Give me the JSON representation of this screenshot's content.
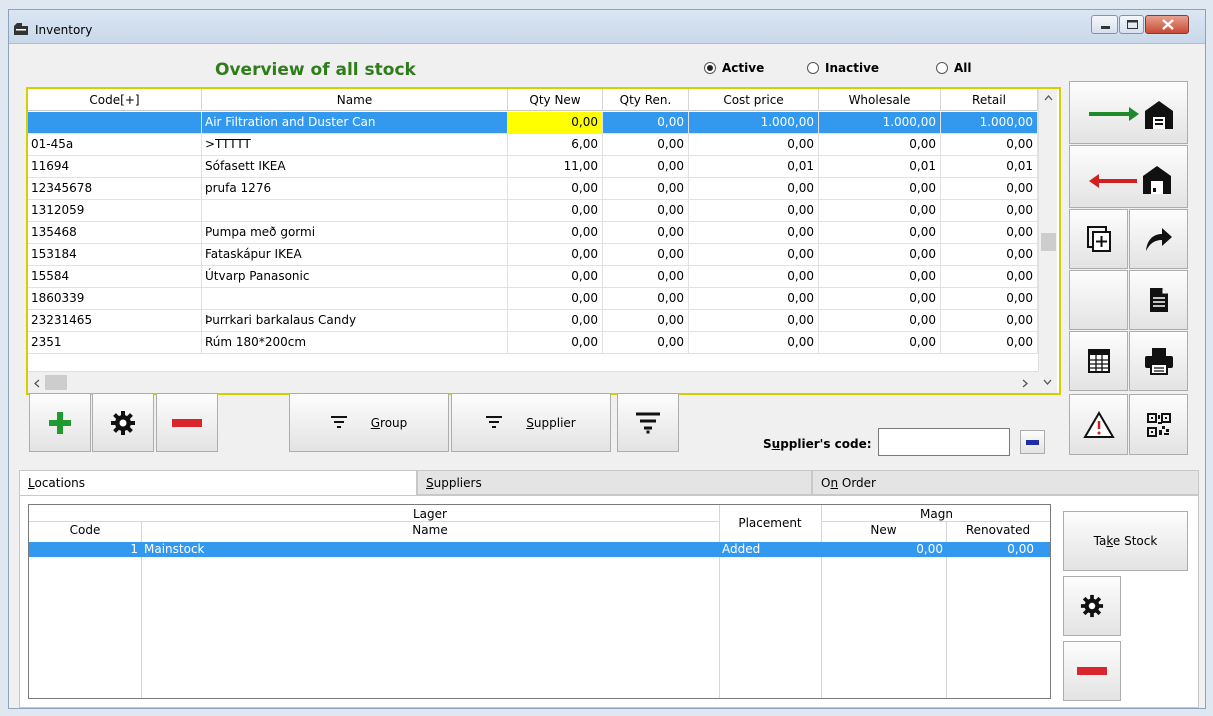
{
  "window": {
    "title": "Inventory"
  },
  "overview": {
    "title": "Overview of all stock"
  },
  "filters": {
    "active": "Active",
    "inactive": "Inactive",
    "all": "All"
  },
  "grid": {
    "columns": [
      "Code[+]",
      "Name",
      "Qty New",
      "Qty Ren.",
      "Cost price",
      "Wholesale",
      "Retail"
    ],
    "rows": [
      [
        "",
        "Air Filtration and Duster Can",
        "0,00",
        "0,00",
        "1.000,00",
        "1.000,00",
        "1.000,00"
      ],
      [
        "01-45a",
        ">TTTTT",
        "6,00",
        "0,00",
        "0,00",
        "0,00",
        "0,00"
      ],
      [
        "11694",
        "Sófasett IKEA",
        "11,00",
        "0,00",
        "0,01",
        "0,01",
        "0,01"
      ],
      [
        "12345678",
        "prufa 1276",
        "0,00",
        "0,00",
        "0,00",
        "0,00",
        "0,00"
      ],
      [
        "1312059",
        "",
        "0,00",
        "0,00",
        "0,00",
        "0,00",
        "0,00"
      ],
      [
        "135468",
        "Pumpa með gormi",
        "0,00",
        "0,00",
        "0,00",
        "0,00",
        "0,00"
      ],
      [
        "153184",
        "Fataskápur IKEA",
        "0,00",
        "0,00",
        "0,00",
        "0,00",
        "0,00"
      ],
      [
        "15584",
        "Útvarp Panasonic",
        "0,00",
        "0,00",
        "0,00",
        "0,00",
        "0,00"
      ],
      [
        "1860339",
        "",
        "0,00",
        "0,00",
        "0,00",
        "0,00",
        "0,00"
      ],
      [
        "23231465",
        "Þurrkari barkalaus Candy",
        "0,00",
        "0,00",
        "0,00",
        "0,00",
        "0,00"
      ],
      [
        "2351",
        "Rúm 180*200cm",
        "0,00",
        "0,00",
        "0,00",
        "0,00",
        "0,00"
      ]
    ]
  },
  "toolbar": {
    "group": {
      "pre": "",
      "key": "G",
      "post": "roup"
    },
    "supplier": {
      "pre": "",
      "key": "S",
      "post": "upplier"
    }
  },
  "supplier_code": {
    "pre": "S",
    "key": "u",
    "post": "pplier's code:",
    "value": ""
  },
  "tabs": {
    "locations": {
      "key": "L",
      "post": "ocations"
    },
    "suppliers": {
      "key": "S",
      "post": "uppliers"
    },
    "onorder": {
      "pre": "O",
      "key": "n",
      "post": " Order"
    }
  },
  "locations": {
    "group_lager": "Lager",
    "group_magn": "Magn",
    "col_code": "Code",
    "col_name": "Name",
    "col_placement": "Placement",
    "col_new": "New",
    "col_renovated": "Renovated",
    "row": {
      "code": "1",
      "name": "Mainstock",
      "placement": "Added",
      "new": "0,00",
      "renovated": "0,00"
    }
  },
  "take_stock": {
    "pre": "Ta",
    "key": "k",
    "post": "e Stock"
  },
  "colors": {
    "accent_green": "#2e7d1a",
    "selection_blue": "#3399ee",
    "highlight_yellow": "#ffff00",
    "remove_red": "#d9262c",
    "add_green": "#1f9a2e"
  }
}
